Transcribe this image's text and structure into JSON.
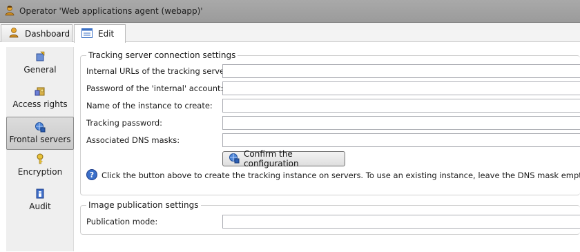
{
  "window": {
    "title": "Operator 'Web applications agent (webapp)'",
    "icon": "operator-icon"
  },
  "tabs": [
    {
      "label": "Dashboard",
      "icon": "dashboard-icon",
      "active": false
    },
    {
      "label": "Edit",
      "icon": "form-icon",
      "active": true
    }
  ],
  "sidebar": {
    "items": [
      {
        "label": "General",
        "icon": "general-icon",
        "selected": false
      },
      {
        "label": "Access rights",
        "icon": "key-lock-icon",
        "selected": false
      },
      {
        "label": "Frontal servers",
        "icon": "globe-servers-icon",
        "selected": true
      },
      {
        "label": "Encryption",
        "icon": "key-icon",
        "selected": false
      },
      {
        "label": "Audit",
        "icon": "audit-icon",
        "selected": false
      }
    ]
  },
  "tracking": {
    "legend": "Tracking server connection settings",
    "fields": [
      {
        "label": "Internal URLs of the tracking servers:",
        "value": ""
      },
      {
        "label": "Password of the 'internal' account:",
        "value": ""
      },
      {
        "label": "Name of the instance to create:",
        "value": ""
      },
      {
        "label": "Tracking password:",
        "value": ""
      },
      {
        "label": "Associated DNS masks:",
        "value": ""
      }
    ],
    "confirm_label": "Confirm the configuration",
    "hint": "Click the button above to create the tracking instance on servers. To use an existing instance, leave the DNS mask empty."
  },
  "publication": {
    "legend": "Image publication settings",
    "fields": [
      {
        "label": "Publication mode:",
        "value": ""
      }
    ]
  },
  "colors": {
    "titlebar": "#a3a3a3",
    "accent_blue": "#2f5fb3",
    "gold": "#d9a300"
  }
}
